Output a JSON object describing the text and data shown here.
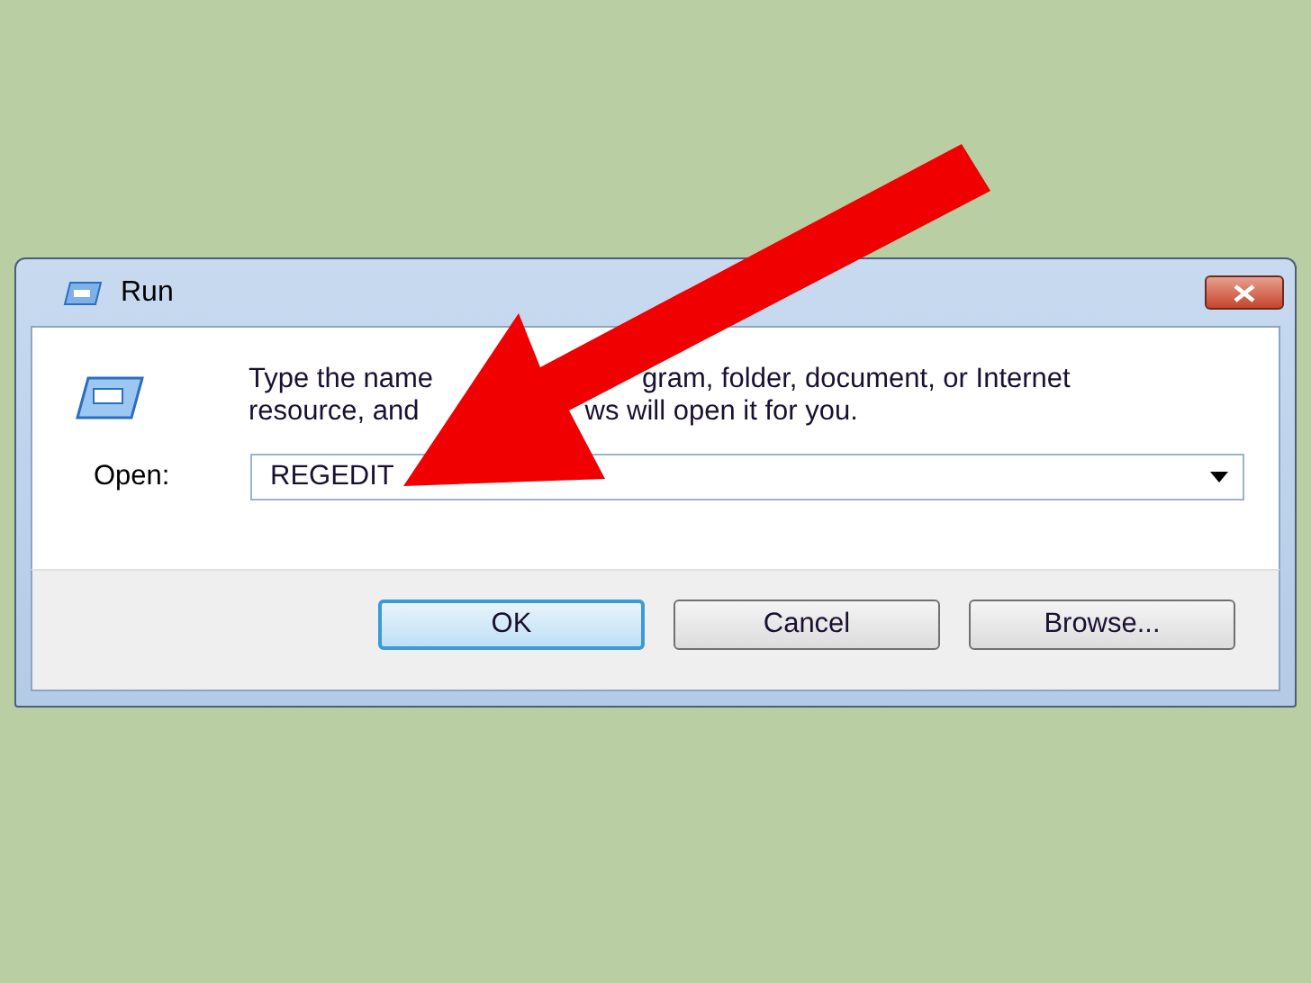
{
  "window": {
    "title": "Run"
  },
  "description": {
    "lines": [
      [
        "Type the name",
        "gram, folder, document, or Internet"
      ],
      [
        "resource, and",
        "ws will open it for you."
      ]
    ]
  },
  "open_field": {
    "label": "Open:",
    "value": "REGEDIT"
  },
  "buttons": [
    {
      "label": "OK",
      "default": true
    },
    {
      "label": "Cancel",
      "default": false
    },
    {
      "label": "Browse...",
      "default": false
    }
  ],
  "overlay": {
    "kind": "arrow"
  }
}
